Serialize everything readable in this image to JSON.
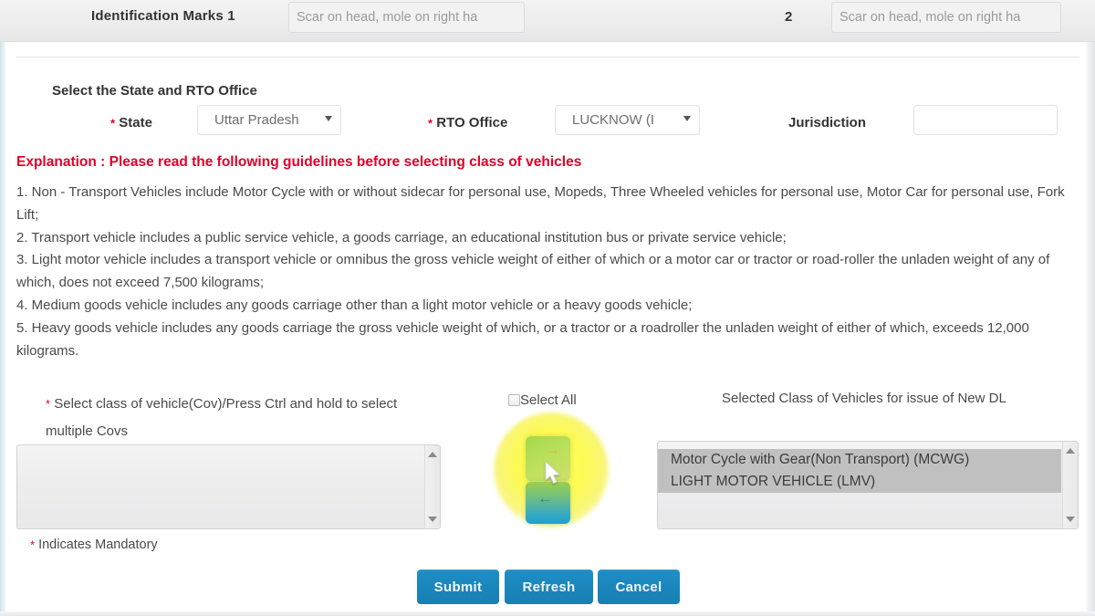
{
  "topbar": {
    "identification_marks_label": "Identification Marks 1",
    "mark1_value": "Scar on head, mole on right ha",
    "mark1_placeholder": "Scar on head, mole on right hand",
    "mark_number_2": "2",
    "mark2_value": "Scar on head, mole on right ha",
    "mark2_placeholder": "Scar on head, mole on right hand"
  },
  "state_section": {
    "title": "Select the State and RTO Office",
    "state_label": "State",
    "state_value": "Uttar Pradesh",
    "rto_label": "RTO Office",
    "rto_value": "LUCKNOW (I",
    "jurisdiction_label": "Jurisdiction",
    "jurisdiction_value": ""
  },
  "explanation": {
    "heading": "Explanation : Please read the following guidelines before selecting class of vehicles",
    "lines": [
      "1. Non - Transport Vehicles include Motor Cycle with or without sidecar for personal use, Mopeds, Three Wheeled vehicles for personal use, Motor Car for personal use, Fork Lift;",
      "2. Transport vehicle includes a public service vehicle, a goods carriage, an educational institution bus or private service vehicle;",
      "3. Light motor vehicle includes a transport vehicle or omnibus the gross vehicle weight of either of which or a motor car or tractor or road-roller the unladen weight of any of which, does not exceed 7,500 kilograms;",
      "4. Medium goods vehicle includes any goods carriage other than a light motor vehicle or a heavy goods vehicle;",
      "5. Heavy goods vehicle includes any goods carriage the gross vehicle weight of which, or a tractor or a roadroller the unladen weight of either of which, exceeds 12,000 kilograms."
    ]
  },
  "cov_section": {
    "instruction": "Select class of vehicle(Cov)/Press Ctrl and hold to select multiple Covs",
    "available_options": [],
    "select_all_label": "Select All",
    "select_all_checked": false,
    "selected_title": "Selected Class of Vehicles for issue of New DL",
    "selected_options": [
      "Motor Cycle with Gear(Non Transport) (MCWG)",
      "LIGHT MOTOR VEHICLE (LMV)"
    ],
    "add_button_glyph": "→",
    "remove_button_glyph": "←",
    "mandatory_note": "Indicates Mandatory",
    "mandatory_marker": "*"
  },
  "actions": {
    "submit_label": "Submit",
    "refresh_label": "Refresh",
    "cancel_label": "Cancel"
  },
  "colors": {
    "required_red": "#e2002a",
    "explanation_red": "#e2002a",
    "button_blue": "#1a85bb",
    "selected_row_gray": "#c0c0c0",
    "cursor_highlight_yellow": "#fdfa46"
  }
}
